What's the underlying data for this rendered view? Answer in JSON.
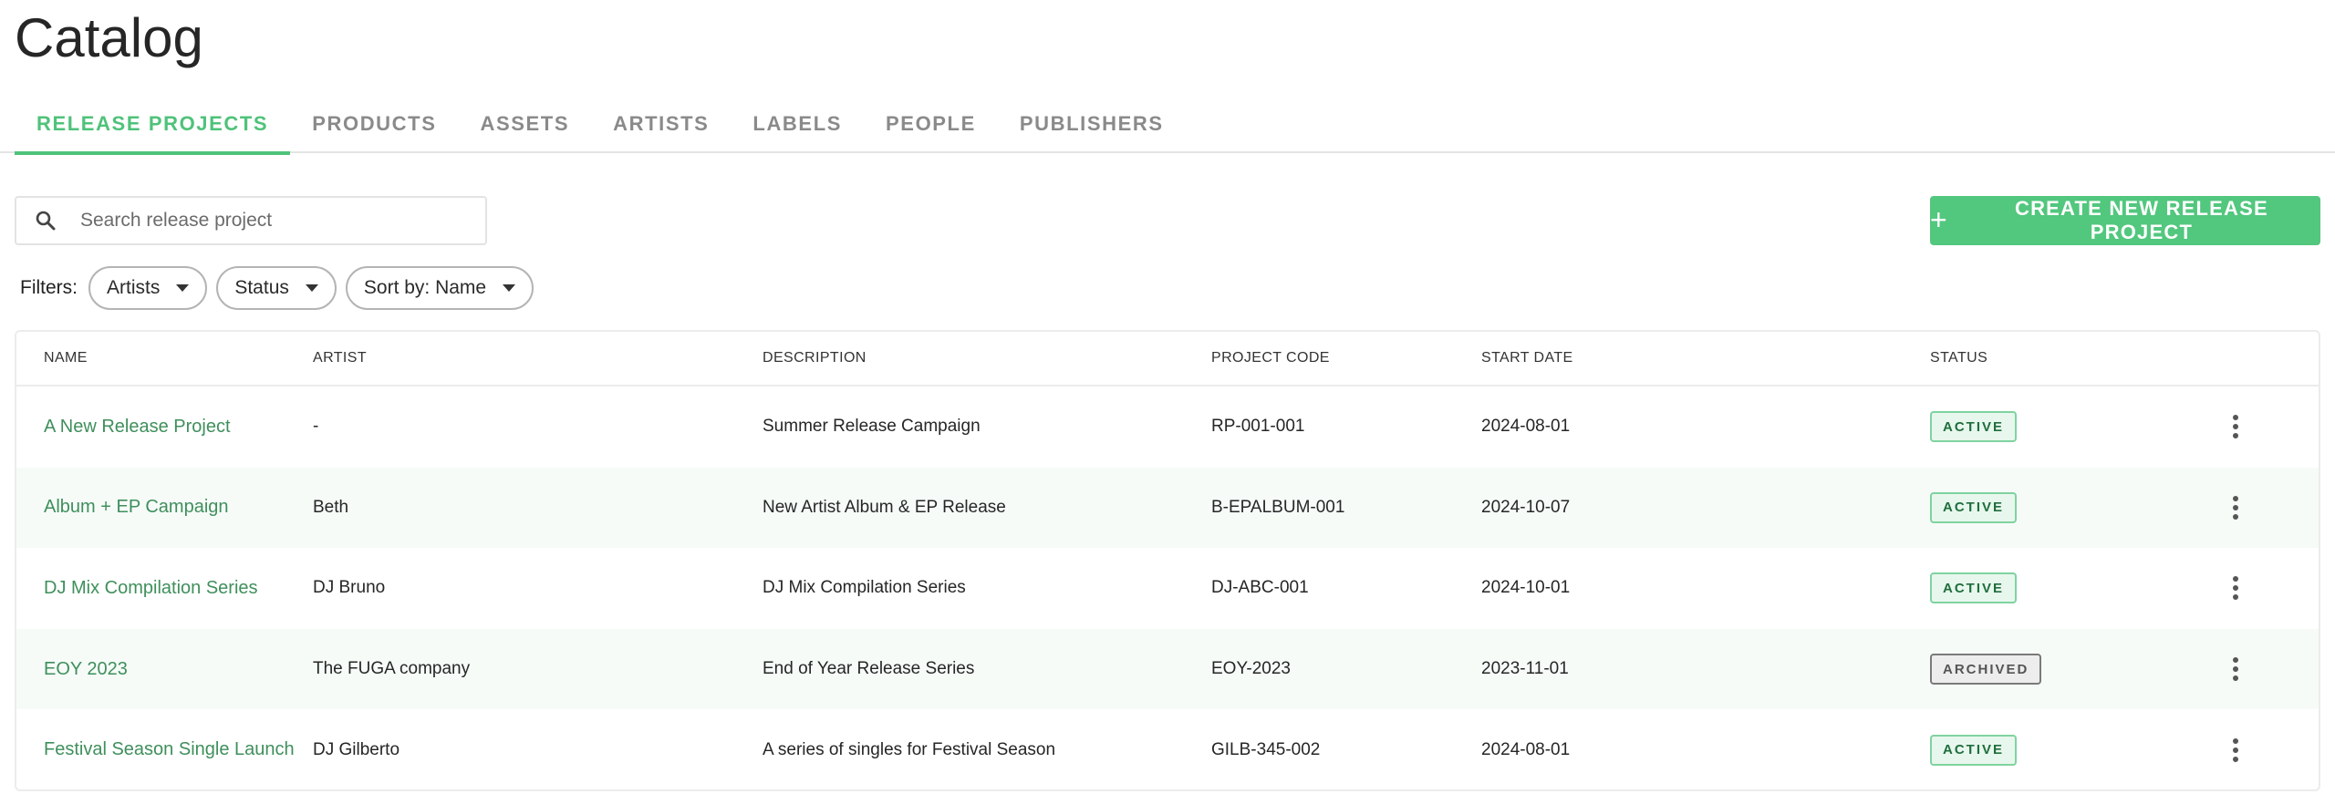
{
  "page": {
    "title": "Catalog"
  },
  "tabs": [
    {
      "label": "RELEASE PROJECTS",
      "active": true
    },
    {
      "label": "PRODUCTS",
      "active": false
    },
    {
      "label": "ASSETS",
      "active": false
    },
    {
      "label": "ARTISTS",
      "active": false
    },
    {
      "label": "LABELS",
      "active": false
    },
    {
      "label": "PEOPLE",
      "active": false
    },
    {
      "label": "PUBLISHERS",
      "active": false
    }
  ],
  "search": {
    "placeholder": "Search release project",
    "value": "",
    "icon": "search-icon"
  },
  "create_button": {
    "label": "CREATE NEW RELEASE PROJECT",
    "icon": "plus-icon",
    "color": "#52c77e"
  },
  "filters": {
    "label": "Filters:",
    "items": [
      {
        "label": "Artists"
      },
      {
        "label": "Status"
      },
      {
        "label": "Sort by: Name"
      }
    ]
  },
  "table": {
    "columns": [
      "NAME",
      "ARTIST",
      "DESCRIPTION",
      "PROJECT CODE",
      "START DATE",
      "STATUS"
    ],
    "rows": [
      {
        "name": "A New Release Project",
        "artist": "-",
        "description": "Summer Release Campaign",
        "code": "RP-001-001",
        "start_date": "2024-08-01",
        "status": "ACTIVE"
      },
      {
        "name": "Album + EP Campaign",
        "artist": "Beth",
        "description": "New Artist Album & EP Release",
        "code": "B-EPALBUM-001",
        "start_date": "2024-10-07",
        "status": "ACTIVE"
      },
      {
        "name": "DJ Mix Compilation Series",
        "artist": "DJ Bruno",
        "description": "DJ Mix Compilation Series",
        "code": "DJ-ABC-001",
        "start_date": "2024-10-01",
        "status": "ACTIVE"
      },
      {
        "name": "EOY 2023",
        "artist": "The FUGA company",
        "description": "End of Year Release Series",
        "code": "EOY-2023",
        "start_date": "2023-11-01",
        "status": "ARCHIVED"
      },
      {
        "name": "Festival Season Single Launch",
        "artist": "DJ Gilberto",
        "description": "A series of singles for Festival Season",
        "code": "GILB-345-002",
        "start_date": "2024-08-01",
        "status": "ACTIVE"
      }
    ]
  },
  "colors": {
    "accent": "#4fc27a",
    "link": "#3f8f5c",
    "active_badge_bg": "#e8f7ee",
    "archived_badge_bg": "#ededed"
  }
}
